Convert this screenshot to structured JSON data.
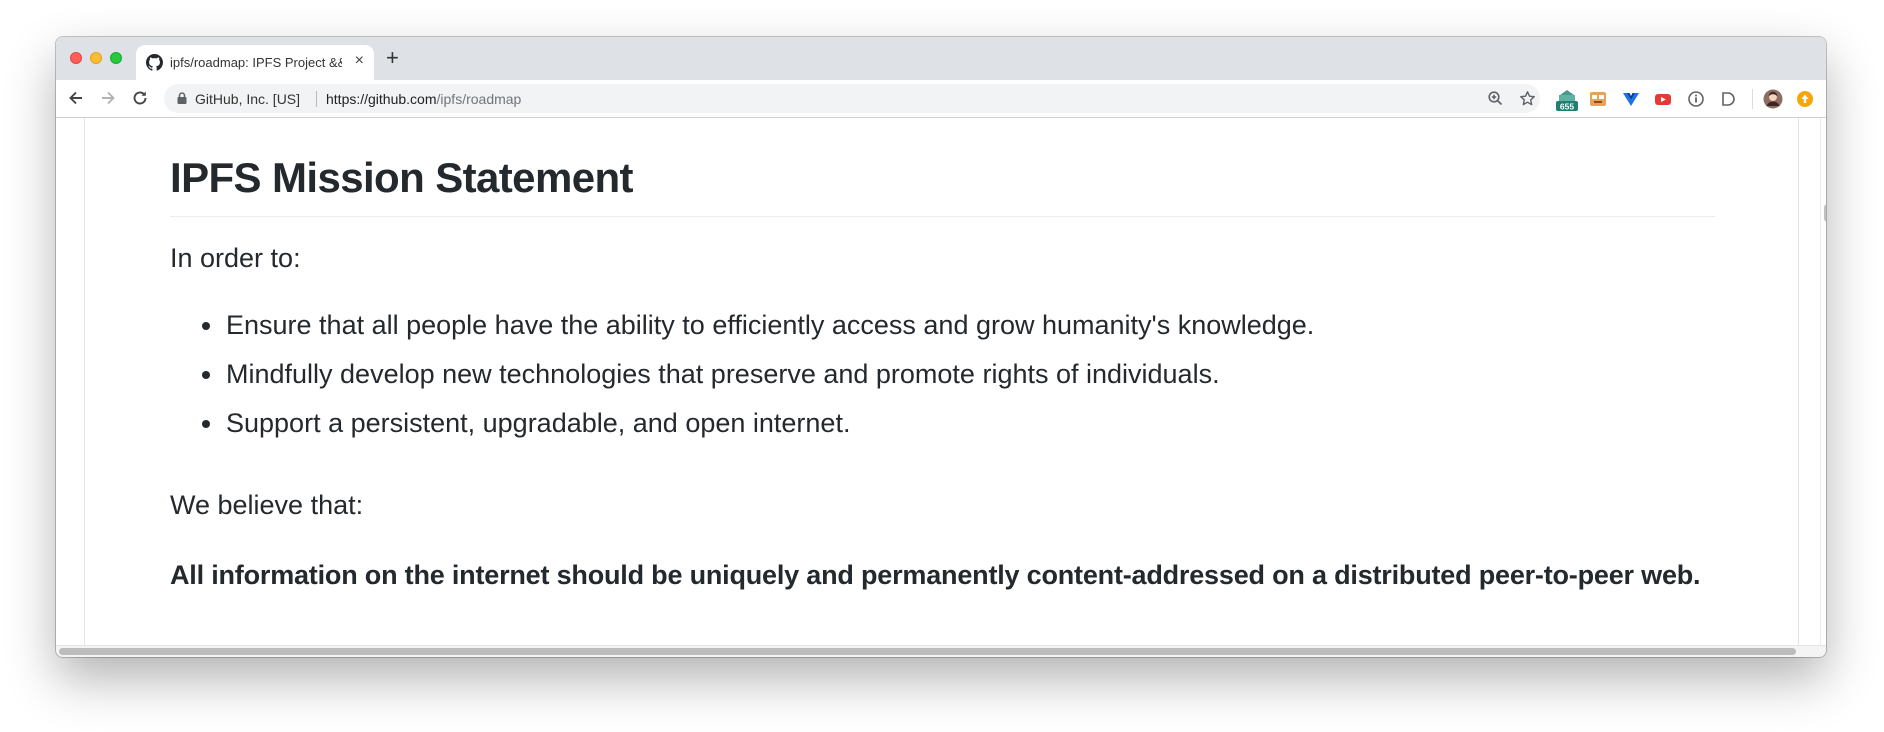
{
  "browser": {
    "tab_title": "ipfs/roadmap: IPFS Project &&",
    "tab_close": "×",
    "new_tab": "+",
    "site_identity": "GitHub, Inc. [US]",
    "url_host": "https://github.com",
    "url_path": "/ipfs/roadmap",
    "extension_badge": "655",
    "icons": [
      "back-arrow-icon",
      "forward-arrow-icon",
      "reload-icon",
      "lock-icon",
      "zoom-icon",
      "star-icon",
      "github-tab-icon"
    ]
  },
  "page": {
    "heading": "IPFS Mission Statement",
    "intro": "In order to:",
    "bullets": [
      "Ensure that all people have the ability to efficiently access and grow humanity's knowledge.",
      "Mindfully develop new technologies that preserve and promote rights of individuals.",
      "Support a persistent, upgradable, and open internet."
    ],
    "belief_intro": "We believe that:",
    "belief": "All information on the internet should be uniquely and permanently content-addressed on a distributed peer-to-peer web."
  },
  "colors": {
    "text": "#24292e",
    "url_path": "#70757a",
    "titlebar": "#dee1e6",
    "omnibox": "#f1f3f4"
  }
}
